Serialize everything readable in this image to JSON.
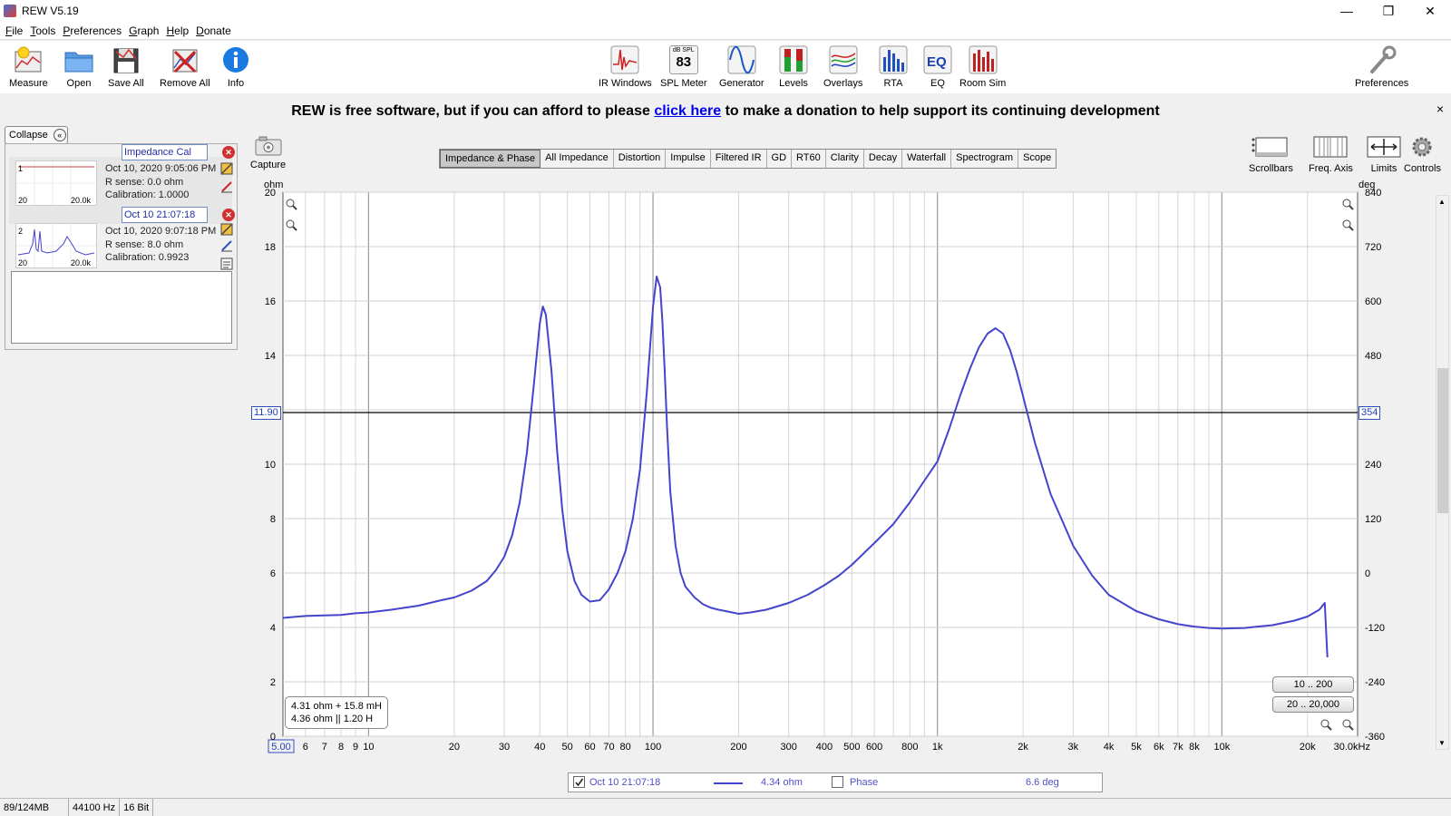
{
  "window": {
    "title": "REW V5.19",
    "controls": [
      "—",
      "❐",
      "✕"
    ]
  },
  "menu": [
    "File",
    "Tools",
    "Preferences",
    "Graph",
    "Help",
    "Donate"
  ],
  "toolbar": {
    "left": [
      "Measure",
      "Open",
      "Save All",
      "Remove All",
      "Info"
    ],
    "center": [
      "IR Windows",
      "SPL Meter",
      "Generator",
      "Levels",
      "Overlays",
      "RTA",
      "EQ",
      "Room Sim"
    ],
    "right": "Preferences",
    "spl_value": "83",
    "spl_unit": "dB SPL"
  },
  "banner": {
    "pre": "REW is free software, but if you can afford to please ",
    "link": "click here",
    "post": " to make a donation to help support its continuing development",
    "close": "×"
  },
  "panel": {
    "collapse_label": "Collapse",
    "measurements": [
      {
        "index": "1",
        "name": "Impedance Cal",
        "date": "Oct 10, 2020 9:05:06 PM",
        "rsense": "R sense: 0.0 ohm",
        "calibration": "Calibration: 1.0000",
        "thumb_min": "20",
        "thumb_max": "20.0k"
      },
      {
        "index": "2",
        "name": "Oct 10 21:07:18",
        "date": "Oct 10, 2020 9:07:18 PM",
        "rsense": "R sense: 8.0 ohm",
        "calibration": "Calibration: 0.9923",
        "thumb_min": "20",
        "thumb_max": "20.0k"
      }
    ]
  },
  "capture_label": "Capture",
  "tabs": [
    "Impedance & Phase",
    "All Impedance",
    "Distortion",
    "Impulse",
    "Filtered IR",
    "GD",
    "RT60",
    "Clarity",
    "Decay",
    "Waterfall",
    "Spectrogram",
    "Scope"
  ],
  "active_tab": "Impedance & Phase",
  "right_tools": [
    "Scrollbars",
    "Freq. Axis",
    "Limits",
    "Controls"
  ],
  "plot": {
    "left_unit": "ohm",
    "right_unit": "deg",
    "cursor_ohm": "11.90",
    "cursor_deg": "354",
    "cursor_freq": "5.00",
    "readout_line1": "4.31 ohm + 15.8 mH",
    "readout_line2": "4.36 ohm || 1.20 H",
    "range_buttons": [
      "10 .. 200",
      "20 .. 20,000"
    ]
  },
  "legend": {
    "name": "Oct 10 21:07:18",
    "value": "4.34 ohm",
    "phase_label": "Phase",
    "phase_value": "6.6 deg"
  },
  "status": [
    "89/124MB",
    "44100 Hz",
    "16 Bit"
  ],
  "colors": {
    "trace": "#4444cc",
    "cursor": "#000000",
    "grid": "#d8d8d8"
  },
  "chart_data": {
    "type": "line",
    "x_scale": "log",
    "xlim": [
      5,
      30000
    ],
    "ylim": [
      0,
      20
    ],
    "y2lim": [
      -360,
      840
    ],
    "x_ticks": [
      5,
      6,
      7,
      8,
      9,
      10,
      20,
      30,
      40,
      50,
      60,
      70,
      80,
      100,
      200,
      300,
      400,
      500,
      600,
      800,
      1000,
      2000,
      3000,
      4000,
      5000,
      6000,
      7000,
      8000,
      10000,
      20000,
      30000
    ],
    "x_tick_labels": [
      "5.00",
      "6",
      "7",
      "8",
      "9",
      "10",
      "20",
      "30",
      "40",
      "50",
      "60",
      "70",
      "80",
      "100",
      "200",
      "300",
      "400",
      "500",
      "600",
      "800",
      "1k",
      "2k",
      "3k",
      "4k",
      "5k",
      "6k",
      "7k",
      "8k",
      "10k",
      "20k",
      "30.0kHz"
    ],
    "y_ticks": [
      0,
      2,
      4,
      6,
      8,
      10,
      12,
      14,
      16,
      18,
      20
    ],
    "y_tick_labels": [
      "0",
      "2",
      "4",
      "6",
      "8",
      "10",
      "",
      "14",
      "16",
      "18",
      "20"
    ],
    "y2_ticks": [
      -360,
      -240,
      -120,
      0,
      120,
      240,
      360,
      480,
      600,
      720,
      840
    ],
    "y2_tick_labels": [
      "-360",
      "-240",
      "-120",
      "0",
      "120",
      "240",
      "",
      "480",
      "600",
      "720",
      "840"
    ],
    "grid": true,
    "cursor_y": 11.9,
    "series": [
      {
        "x": [
          5,
          6,
          7,
          8,
          9,
          10,
          12,
          15,
          18,
          20,
          23,
          26,
          28,
          30,
          32,
          34,
          36,
          38,
          40,
          41,
          42,
          44,
          46,
          48,
          50,
          53,
          56,
          60,
          65,
          70,
          75,
          80,
          85,
          90,
          95,
          100,
          103,
          106,
          108,
          110,
          112,
          115,
          120,
          125,
          130,
          140,
          150,
          160,
          170,
          180,
          190,
          200,
          220,
          250,
          300,
          350,
          400,
          450,
          500,
          600,
          700,
          800,
          900,
          1000,
          1100,
          1200,
          1300,
          1400,
          1500,
          1600,
          1700,
          1800,
          1900,
          2000,
          2200,
          2500,
          3000,
          3500,
          4000,
          5000,
          6000,
          7000,
          8000,
          9000,
          10000,
          12000,
          15000,
          18000,
          20000,
          22000,
          23000,
          23500
        ],
        "y": [
          4.35,
          4.42,
          4.44,
          4.46,
          4.52,
          4.55,
          4.65,
          4.8,
          5.0,
          5.1,
          5.35,
          5.7,
          6.1,
          6.6,
          7.4,
          8.6,
          10.4,
          12.8,
          15.2,
          15.8,
          15.5,
          13.4,
          10.5,
          8.3,
          6.8,
          5.7,
          5.2,
          4.95,
          5.0,
          5.4,
          6.0,
          6.8,
          8.0,
          9.8,
          12.6,
          15.8,
          16.9,
          16.5,
          15.2,
          13.4,
          11.4,
          9.0,
          7.0,
          6.0,
          5.5,
          5.1,
          4.85,
          4.72,
          4.65,
          4.6,
          4.55,
          4.5,
          4.55,
          4.65,
          4.9,
          5.2,
          5.55,
          5.9,
          6.3,
          7.1,
          7.8,
          8.6,
          9.4,
          10.1,
          11.3,
          12.5,
          13.5,
          14.3,
          14.8,
          15.0,
          14.8,
          14.2,
          13.4,
          12.5,
          10.8,
          8.9,
          7.0,
          5.9,
          5.2,
          4.6,
          4.3,
          4.12,
          4.03,
          3.98,
          3.96,
          3.98,
          4.08,
          4.25,
          4.4,
          4.65,
          4.9,
          2.9
        ]
      }
    ]
  }
}
